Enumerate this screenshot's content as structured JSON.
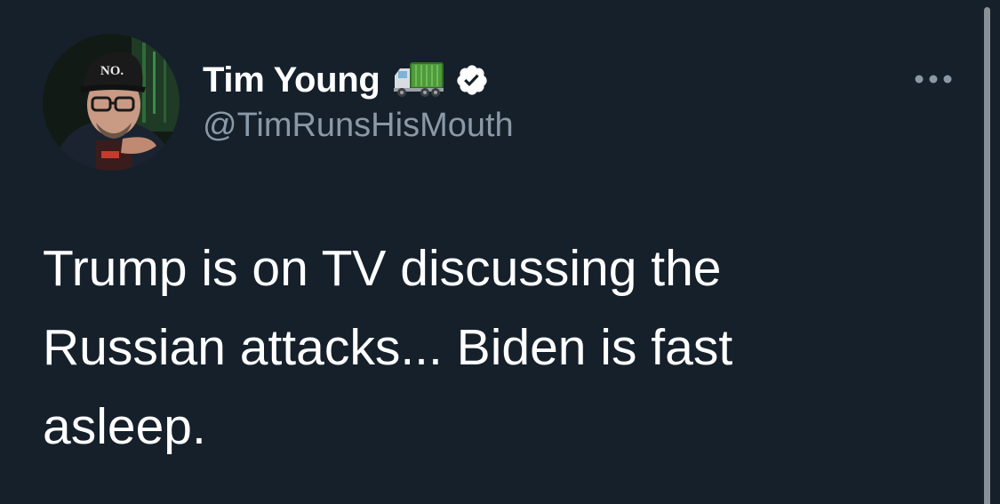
{
  "tweet": {
    "author": {
      "display_name": "Tim Young",
      "handle": "@TimRunsHisMouth",
      "verified": true,
      "name_emoji": "truck-icon",
      "avatar_hat_text": "NO."
    },
    "text": "Trump is on TV discussing the Russian attacks... Biden is fast asleep.",
    "more_icon": "more-horizontal-icon"
  },
  "colors": {
    "background": "#15202b",
    "text_primary": "#ffffff",
    "text_secondary": "#8b98a5",
    "verified_badge": "#ffffff",
    "scrollbar": "#8a9097"
  }
}
